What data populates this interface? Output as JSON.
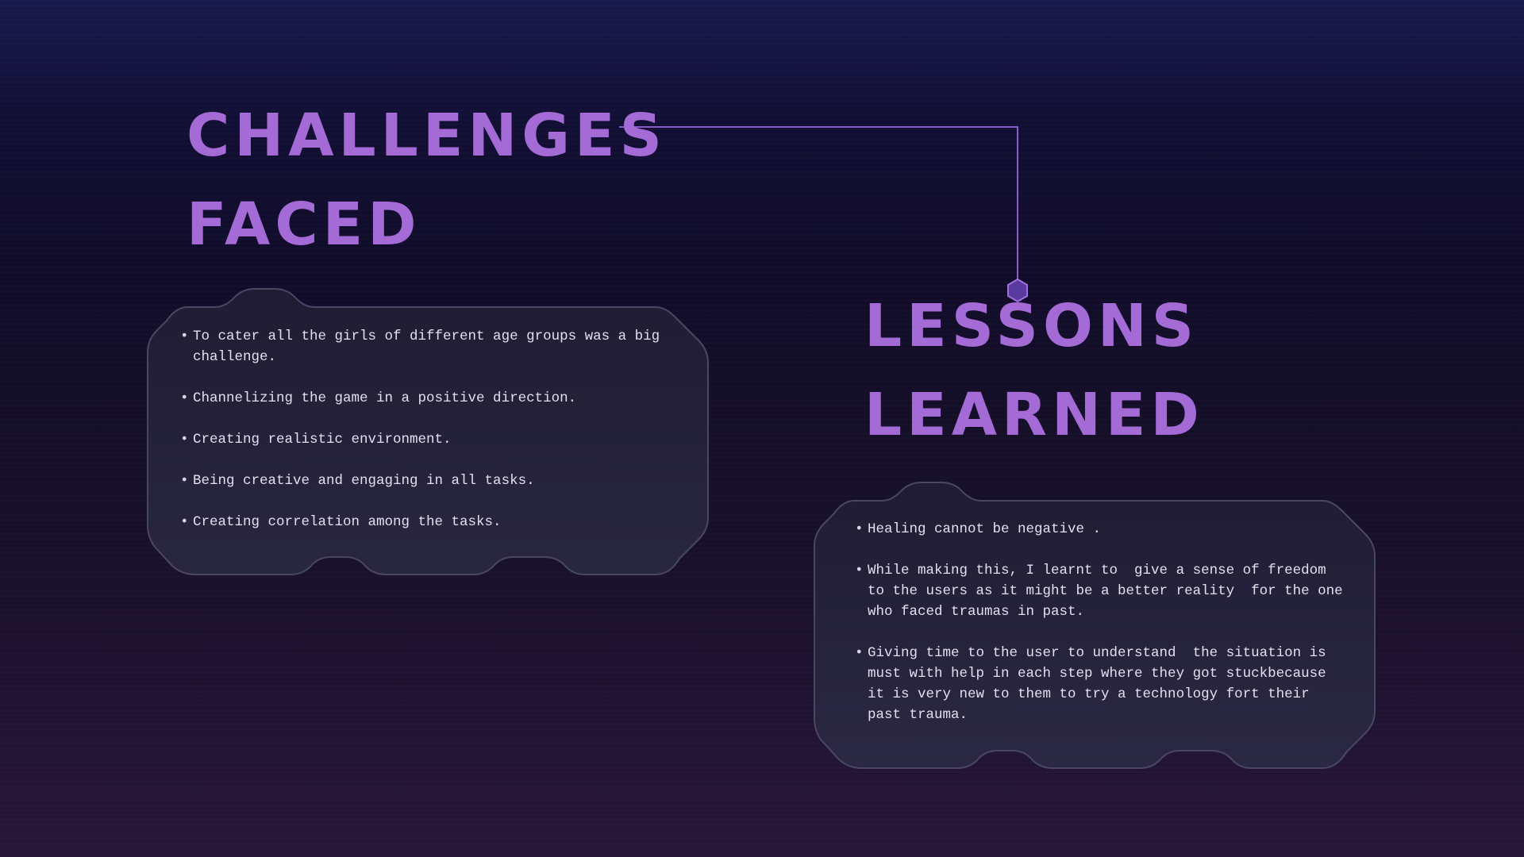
{
  "slide": {
    "challenges": {
      "title_line1": "CHALLENGES",
      "title_line2": "FACED",
      "items": [
        "To cater all the girls of different age groups was a big challenge.",
        "Channelizing the game in a positive direction.",
        "Creating realistic environment.",
        "Being creative and engaging in all tasks.",
        "Creating correlation among the tasks."
      ]
    },
    "lessons": {
      "title_line1": "LESSONS",
      "title_line2": "LEARNED",
      "items": [
        "Healing cannot be negative .",
        "While making this, I learnt to  give a sense of freedom to the users as it might be a better reality  for the one who faced traumas in past.",
        "Giving time to the user to understand  the situation is must with help in each step where they got stuckbecause it is very new to them to try a technology fort their past trauma."
      ]
    },
    "colors": {
      "accent": "#a46bd6",
      "text": "#e2dfee",
      "panel_fill": "#24213a",
      "panel_stroke": "#4a4764"
    },
    "icons": {
      "connector_node": "hexagon-icon"
    }
  }
}
